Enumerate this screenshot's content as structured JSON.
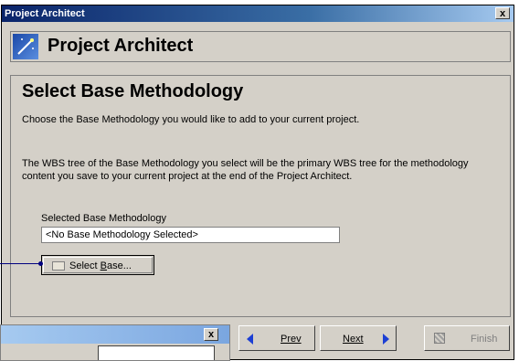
{
  "window": {
    "title": "Project Architect",
    "close_label": "x"
  },
  "header": {
    "title": "Project Architect",
    "icon": "wizard-wand-icon"
  },
  "page": {
    "title": "Select Base Methodology",
    "description": "Choose the Base Methodology you would like to add to your current project.",
    "note": "The WBS tree of the Base Methodology you select will be the primary WBS tree for the methodology content you save to your current project at the end of the Project Architect."
  },
  "selection": {
    "label": "Selected Base Methodology",
    "value": "<No Base Methodology Selected>",
    "button_prefix": "Select ",
    "button_underline": "B",
    "button_suffix": "ase...",
    "button_icon": "folder-icon"
  },
  "nav": {
    "prev_label": "Prev",
    "next_label": "Next",
    "finish_label": "Finish"
  },
  "second_window": {
    "close_label": "x"
  },
  "colors": {
    "titlebar": "#0a246a",
    "arrow": "#1c3fd4",
    "face": "#d4d0c8"
  }
}
